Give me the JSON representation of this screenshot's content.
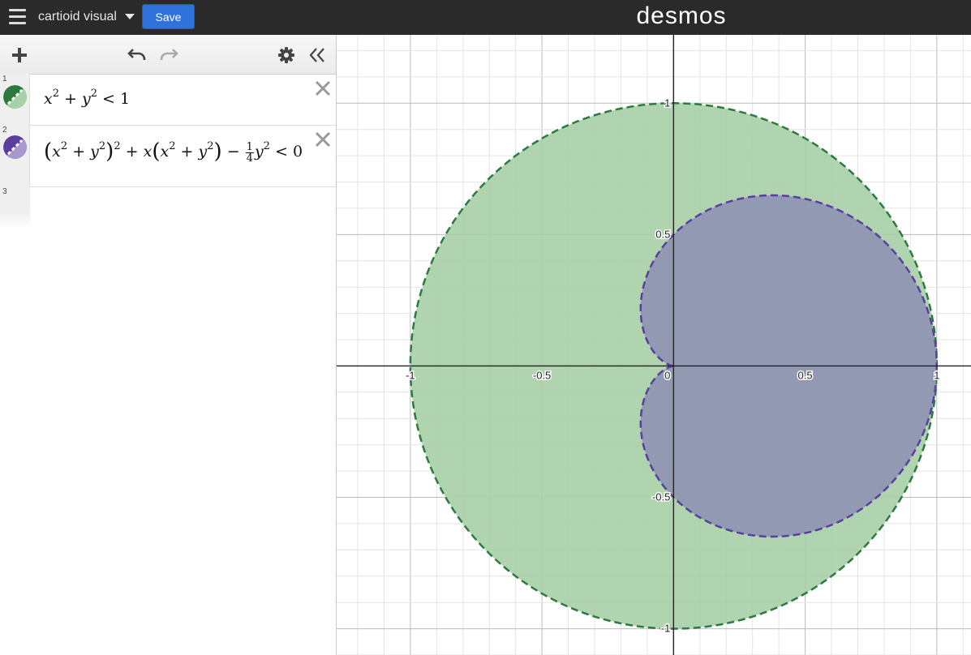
{
  "header": {
    "title": "cartioid visual",
    "save_label": "Save",
    "logo": "desmos"
  },
  "toolbar": {
    "icons": [
      "plus-icon",
      "undo-icon",
      "redo-icon",
      "gear-icon",
      "collapse-icon"
    ]
  },
  "expressions": [
    {
      "index": "1",
      "color": "#2d7a3e",
      "fill_color": "#a8d0a8",
      "latex": "x^2+y^2<1"
    },
    {
      "index": "2",
      "color": "#5b3e9e",
      "fill_color": "#a898d0",
      "latex": "(x^2+y^2)^2+x(x^2+y^2)-\\frac{1}{4}y^2<0"
    },
    {
      "index": "3"
    }
  ],
  "graph": {
    "x_ticks": [
      "-1",
      "-0.5",
      "0",
      "0.5",
      "1"
    ],
    "y_ticks": [
      "1",
      "0.5",
      "-0.5",
      "-1"
    ],
    "x_range": [
      -1.28,
      1.13
    ],
    "y_range": [
      -1.1,
      1.26
    ],
    "grid": true,
    "colors": {
      "circle": "#2d7a3e",
      "cardioid": "#5b3e9e",
      "circle_fill": "#a6cfa6",
      "cardioid_fill": "#8f96b3"
    }
  }
}
